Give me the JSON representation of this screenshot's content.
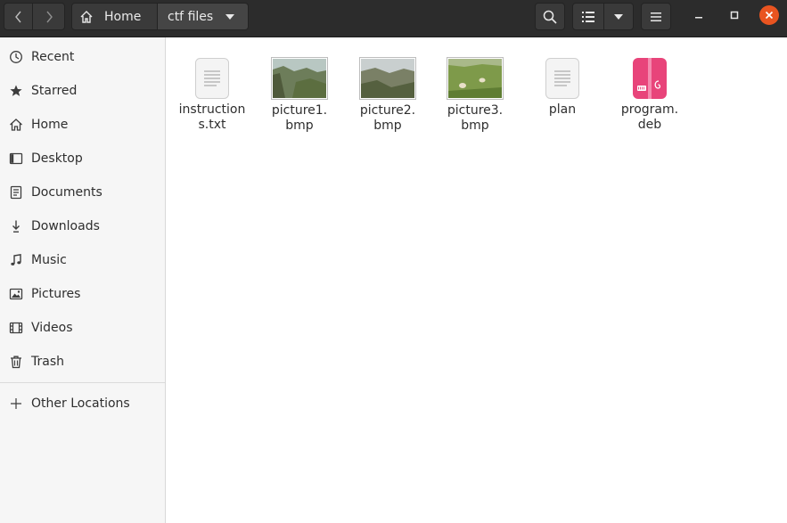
{
  "headerbar": {
    "path": [
      {
        "label": "Home",
        "icon": "home-icon"
      },
      {
        "label": "ctf files",
        "icon": "chevron-down-icon"
      }
    ],
    "buttons": [
      "back-icon",
      "forward-icon",
      "search-icon",
      "list-view-icon",
      "chevron-down-icon",
      "hamburger-menu-icon"
    ],
    "window_controls": [
      "minimize-icon",
      "maximize-icon",
      "close-icon"
    ],
    "colors": {
      "bg": "#2c2c2c",
      "button": "#3a3a3a",
      "close": "#e95420"
    }
  },
  "sidebar": {
    "items": [
      {
        "label": "Recent",
        "icon": "clock-icon"
      },
      {
        "label": "Starred",
        "icon": "star-icon"
      },
      {
        "label": "Home",
        "icon": "home-icon"
      },
      {
        "label": "Desktop",
        "icon": "desktop-icon"
      },
      {
        "label": "Documents",
        "icon": "documents-icon"
      },
      {
        "label": "Downloads",
        "icon": "download-icon"
      },
      {
        "label": "Music",
        "icon": "music-icon"
      },
      {
        "label": "Pictures",
        "icon": "pictures-icon"
      },
      {
        "label": "Videos",
        "icon": "videos-icon"
      },
      {
        "label": "Trash",
        "icon": "trash-icon"
      }
    ],
    "other_locations": {
      "label": "Other Locations",
      "icon": "plus-icon"
    }
  },
  "files": [
    {
      "line1": "instruction",
      "line2": "s.txt",
      "icon": "text-file-icon"
    },
    {
      "line1": "picture1.",
      "line2": "bmp",
      "icon": "image-thumbnail"
    },
    {
      "line1": "picture2.",
      "line2": "bmp",
      "icon": "image-thumbnail"
    },
    {
      "line1": "picture3.",
      "line2": "bmp",
      "icon": "image-thumbnail"
    },
    {
      "line1": "plan",
      "line2": "",
      "icon": "text-file-icon"
    },
    {
      "line1": "program.",
      "line2": "deb",
      "icon": "debian-package-icon"
    }
  ]
}
